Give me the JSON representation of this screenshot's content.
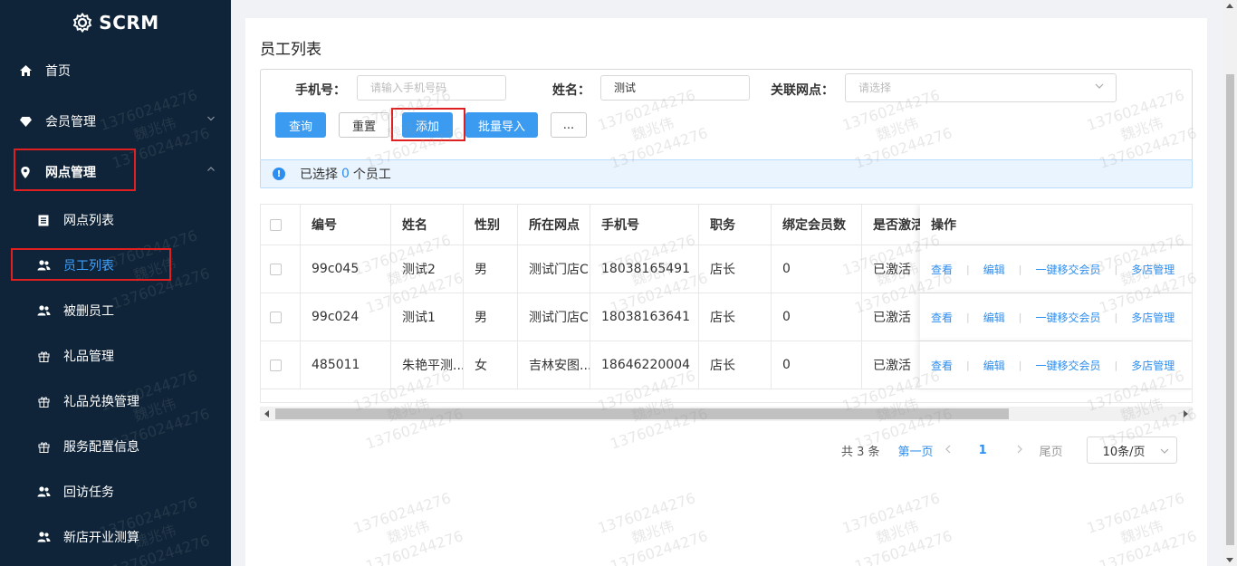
{
  "app": {
    "name": "SCRM"
  },
  "sidebar": {
    "items": [
      {
        "label": "首页",
        "icon": "home-icon"
      },
      {
        "label": "会员管理",
        "icon": "diamond-icon"
      },
      {
        "label": "网点管理",
        "icon": "location-pin-icon"
      },
      {
        "label": "网点列表",
        "icon": "list-icon"
      },
      {
        "label": "员工列表",
        "icon": "users-icon",
        "active": true
      },
      {
        "label": "被删员工",
        "icon": "users-icon"
      },
      {
        "label": "礼品管理",
        "icon": "gift-icon"
      },
      {
        "label": "礼品兑换管理",
        "icon": "gift-icon"
      },
      {
        "label": "服务配置信息",
        "icon": "gift-icon"
      },
      {
        "label": "回访任务",
        "icon": "users-icon"
      },
      {
        "label": "新店开业测算",
        "icon": "users-icon"
      }
    ]
  },
  "page": {
    "title": "员工列表"
  },
  "filters": {
    "phone_label": "手机号：",
    "phone_placeholder": "请输入手机号码",
    "name_label": "姓名：",
    "name_value": "测试",
    "branch_label": "关联网点：",
    "branch_placeholder": "请选择"
  },
  "buttons": {
    "query": "查询",
    "reset": "重置",
    "add": "添加",
    "batch_import": "批量导入",
    "more": "..."
  },
  "selection": {
    "prefix": "已选择",
    "count": "0",
    "suffix": "个员工"
  },
  "table": {
    "headers": [
      "编号",
      "姓名",
      "性别",
      "所在网点",
      "手机号",
      "职务",
      "绑定会员数",
      "是否激活",
      "操作"
    ],
    "rows": [
      {
        "id": "99c045",
        "name": "测试2",
        "gender": "男",
        "branch": "测试门店C",
        "phone": "18038165491",
        "role": "店长",
        "members": "0",
        "active": "已激活"
      },
      {
        "id": "99c024",
        "name": "测试1",
        "gender": "男",
        "branch": "测试门店C",
        "phone": "18038163641",
        "role": "店长",
        "members": "0",
        "active": "已激活"
      },
      {
        "id": "485011",
        "name": "朱艳平测...",
        "gender": "女",
        "branch": "吉林安图...",
        "phone": "18646220004",
        "role": "店长",
        "members": "0",
        "active": "已激活"
      }
    ],
    "actions": [
      "查看",
      "编辑",
      "一键移交会员",
      "多店管理"
    ]
  },
  "pagination": {
    "total": "共 3 条",
    "first": "第一页",
    "current": "1",
    "last": "尾页",
    "page_size": "10条/页"
  },
  "watermark": {
    "line1": "13760244276",
    "line2": "魏兆伟"
  },
  "colors": {
    "sidebar_bg": "#0f2438",
    "primary": "#3a9bf0",
    "link": "#2c8ef0",
    "highlight_box": "#e02020"
  }
}
